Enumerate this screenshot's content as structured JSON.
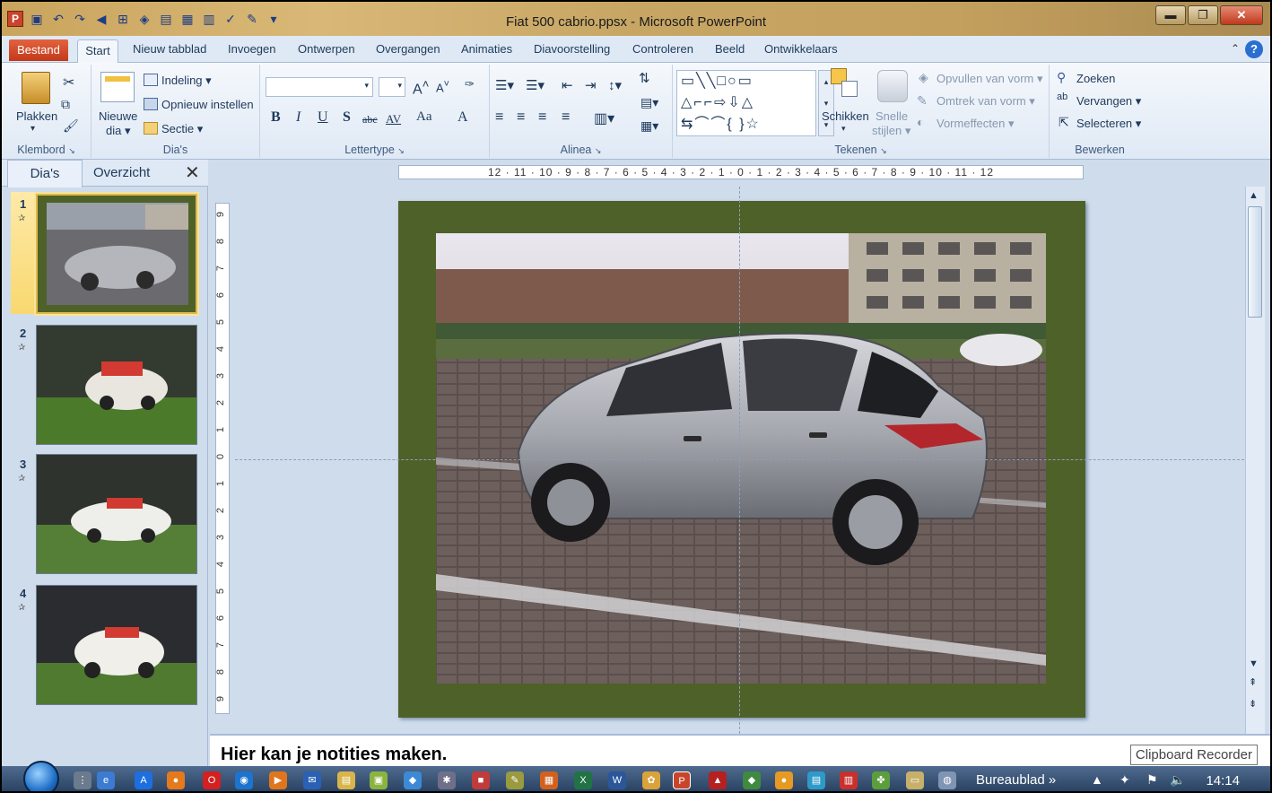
{
  "window": {
    "title": "Fiat 500 cabrio.ppsx - Microsoft PowerPoint",
    "buttons": [
      "minimize",
      "restore",
      "close"
    ]
  },
  "ribbon_tabs": [
    "Bestand",
    "Start",
    "Nieuw tabblad",
    "Invoegen",
    "Ontwerpen",
    "Overgangen",
    "Animaties",
    "Diavoorstelling",
    "Controleren",
    "Beeld",
    "Ontwikkelaars"
  ],
  "ribbon": {
    "clipboard": {
      "paste": "Plakken",
      "label": "Klembord"
    },
    "slides": {
      "new_slide_1": "Nieuwe",
      "new_slide_2": "dia",
      "layout": "Indeling",
      "reset": "Opnieuw instellen",
      "section": "Sectie",
      "label": "Dia's"
    },
    "font": {
      "label": "Lettertype",
      "bold": "B",
      "italic": "I",
      "underline": "U",
      "shadow": "S",
      "strike": "abc",
      "spacing": "AV",
      "case": "Aa",
      "color": "A",
      "grow": "A",
      "shrink": "A"
    },
    "paragraph": {
      "label": "Alinea"
    },
    "drawing": {
      "arrange": "Schikken",
      "quick_styles_1": "Snelle",
      "quick_styles_2": "stijlen",
      "fill": "Opvullen van vorm",
      "outline": "Omtrek van vorm",
      "effects": "Vormeffecten",
      "label": "Tekenen"
    },
    "editing": {
      "find": "Zoeken",
      "replace": "Vervangen",
      "select": "Selecteren",
      "label": "Bewerken"
    }
  },
  "panel": {
    "tabs": [
      "Dia's",
      "Overzicht"
    ],
    "close": "✕"
  },
  "slides": [
    {
      "number": "1",
      "selected": true
    },
    {
      "number": "2",
      "selected": false
    },
    {
      "number": "3",
      "selected": false
    },
    {
      "number": "4",
      "selected": false
    }
  ],
  "ruler": {
    "horizontal": "12 · 11 · 10 · 9 · 8 · 7 · 6 · 5 · 4 · 3 · 2 · 1 · 0 · 1 · 2 · 3 · 4 · 5 · 6 · 7 · 8 · 9 · 10 · 11 · 12",
    "vertical": [
      "9",
      "8",
      "7",
      "6",
      "5",
      "4",
      "3",
      "2",
      "1",
      "0",
      "1",
      "2",
      "3",
      "4",
      "5",
      "6",
      "7",
      "8",
      "9"
    ]
  },
  "notes": {
    "text": "Hier kan je notities maken."
  },
  "tooltip": "Clipboard Recorder",
  "taskbar": {
    "desktop": "Bureaublad",
    "clock": "14:14",
    "chevron": "»"
  },
  "colors": {
    "slide_bg": "#4e6129",
    "ribbon_bg": "#dfe9f5",
    "file_tab": "#c2391a",
    "title_bar": "#c9a45c",
    "selected_thumb": "#e0b94a"
  }
}
